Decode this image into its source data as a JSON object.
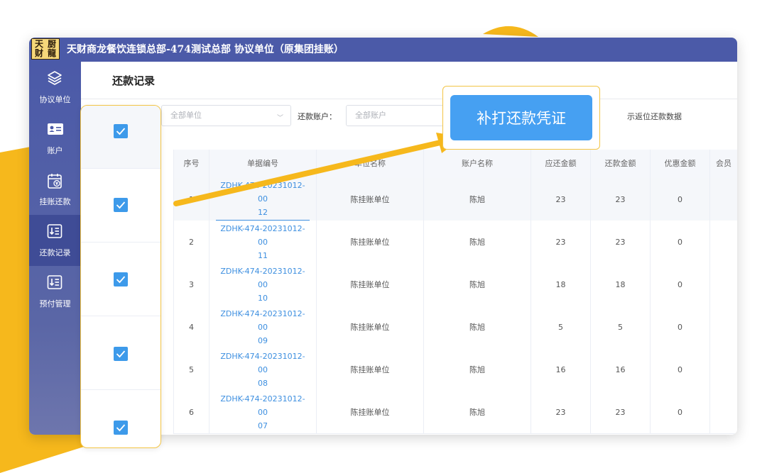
{
  "app": {
    "logo_chars": [
      "天",
      "厨",
      "财",
      "龍"
    ],
    "title": "天财商龙餐饮连锁总部-474测试总部 协议单位（原集团挂账）"
  },
  "sidebar": {
    "items": [
      {
        "label": "协议单位",
        "icon": "layers-icon"
      },
      {
        "label": "账户",
        "icon": "id-card-icon"
      },
      {
        "label": "挂账还款",
        "icon": "calendar-yen-icon"
      },
      {
        "label": "还款记录",
        "icon": "download-list-icon",
        "active": true
      },
      {
        "label": "预付管理",
        "icon": "download-list-icon"
      }
    ]
  },
  "page": {
    "title": "还款记录",
    "filters": {
      "unit_placeholder": "全部单位",
      "account_label": "还款账户：",
      "account_placeholder": "全部账户",
      "extra_text": "示返位还款数据"
    }
  },
  "callout": {
    "button_label": "补打还款凭证"
  },
  "table": {
    "headers": [
      "序号",
      "单据编号",
      "单位名称",
      "账户名称",
      "应还金额",
      "还款金额",
      "优惠金额",
      "会员"
    ],
    "rows": [
      {
        "seq": "1",
        "bill_no": [
          "ZDHK-474-20231012-00",
          "12"
        ],
        "unit": "陈挂账单位",
        "account": "陈旭",
        "due": "23",
        "paid": "23",
        "discount": "0"
      },
      {
        "seq": "2",
        "bill_no": [
          "ZDHK-474-20231012-00",
          "11"
        ],
        "unit": "陈挂账单位",
        "account": "陈旭",
        "due": "23",
        "paid": "23",
        "discount": "0"
      },
      {
        "seq": "3",
        "bill_no": [
          "ZDHK-474-20231012-00",
          "10"
        ],
        "unit": "陈挂账单位",
        "account": "陈旭",
        "due": "18",
        "paid": "18",
        "discount": "0"
      },
      {
        "seq": "4",
        "bill_no": [
          "ZDHK-474-20231012-00",
          "09"
        ],
        "unit": "陈挂账单位",
        "account": "陈旭",
        "due": "5",
        "paid": "5",
        "discount": "0"
      },
      {
        "seq": "5",
        "bill_no": [
          "ZDHK-474-20231012-00",
          "08"
        ],
        "unit": "陈挂账单位",
        "account": "陈旭",
        "due": "16",
        "paid": "16",
        "discount": "0"
      },
      {
        "seq": "6",
        "bill_no": [
          "ZDHK-474-20231012-00",
          "07"
        ],
        "unit": "陈挂账单位",
        "account": "陈旭",
        "due": "23",
        "paid": "23",
        "discount": "0"
      }
    ]
  },
  "colors": {
    "accent_yellow": "#f6b81c",
    "titlebar": "#4b5aa8",
    "link": "#3d8fe0",
    "checkbox": "#3d9aea"
  }
}
